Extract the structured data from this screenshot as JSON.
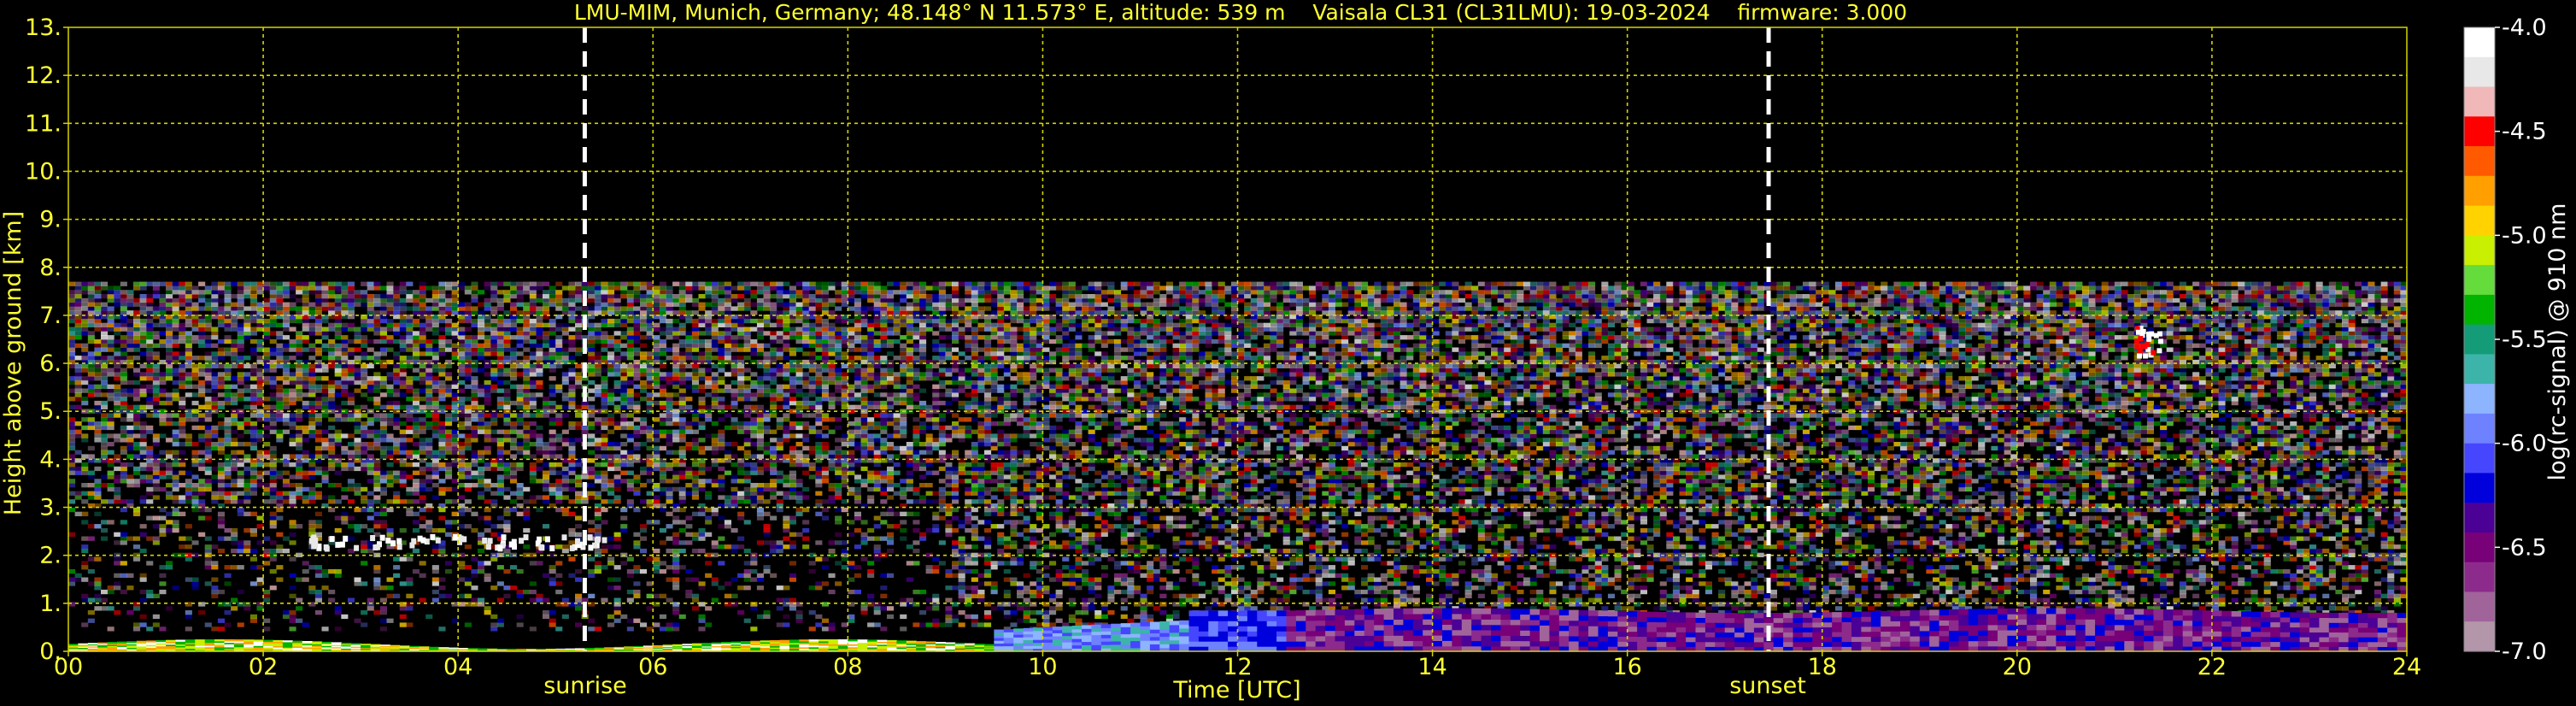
{
  "chart_data": {
    "type": "heatmap",
    "title": "LMU-MIM, Munich, Germany; 48.148° N 11.573° E, altitude: 539 m    Vaisala CL31 (CL31LMU): 19-03-2024    firmware: 3.000",
    "xlabel": "Time [UTC]",
    "ylabel": "Height above ground [km]",
    "xlim": [
      0,
      24
    ],
    "ylim": [
      0,
      13
    ],
    "x_ticks": [
      "00",
      "02",
      "04",
      "06",
      "08",
      "10",
      "12",
      "14",
      "16",
      "18",
      "20",
      "22",
      "24"
    ],
    "x_tick_values": [
      0,
      2,
      4,
      6,
      8,
      10,
      12,
      14,
      16,
      18,
      20,
      22,
      24
    ],
    "y_ticks": [
      "0.",
      "1.",
      "2.",
      "3.",
      "4.",
      "5.",
      "6.",
      "7.",
      "8.",
      "9.",
      "10.",
      "11.",
      "12.",
      "13."
    ],
    "y_tick_values": [
      0,
      1,
      2,
      3,
      4,
      5,
      6,
      7,
      8,
      9,
      10,
      11,
      12,
      13
    ],
    "grid": true,
    "max_data_height_km": 7.7,
    "annotations": [
      {
        "label": "sunrise",
        "time_utc": 5.3
      },
      {
        "label": "sunset",
        "time_utc": 17.45
      }
    ],
    "colorbar": {
      "label": "log(rc-signal) @ 910 nm",
      "range": [
        -7.0,
        -4.0
      ],
      "ticks": [
        "-4.0",
        "-4.5",
        "-5.0",
        "-5.5",
        "-6.0",
        "-6.5",
        "-7.0"
      ],
      "tick_values": [
        -4.0,
        -4.5,
        -5.0,
        -5.5,
        -6.0,
        -6.5,
        -7.0
      ],
      "colors": [
        "#ffffff",
        "#e8e8e8",
        "#f0b8b8",
        "#ff0000",
        "#ff5a00",
        "#ffa000",
        "#ffd200",
        "#c8f000",
        "#64dc3c",
        "#00b400",
        "#149b78",
        "#3cb4aa",
        "#8cb4ff",
        "#6e82ff",
        "#4646ff",
        "#0000dc",
        "#4b0096",
        "#780078",
        "#8c2b8c",
        "#a0649b",
        "#b496aa"
      ]
    },
    "colors": {
      "text": "#ffff33",
      "grid": "#d4d400",
      "marker": "#ffffff",
      "background": "#000000"
    }
  }
}
